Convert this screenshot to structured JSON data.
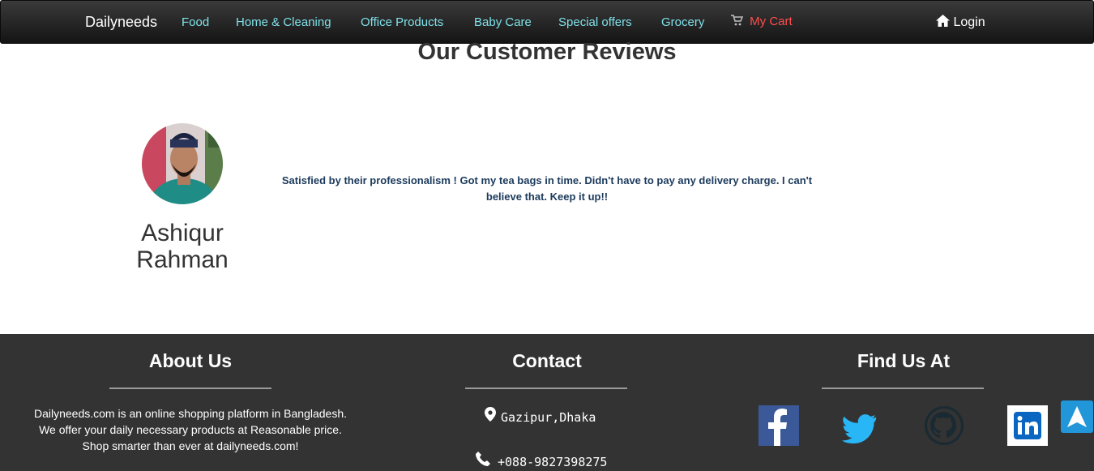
{
  "navbar": {
    "brand": "Dailyneeds",
    "links": [
      "Food",
      "Home & Cleaning",
      "Office Products",
      "Baby Care",
      "Special offers",
      "Grocery"
    ],
    "cart_label": "My Cart",
    "login_label": "Login",
    "link_color": "#7fe0e8",
    "cart_color": "#ff4d4d"
  },
  "reviews": {
    "title": "Our Customer Reviews",
    "items": [
      {
        "name_line1": "Ashiqur",
        "name_line2": "Rahman",
        "text": "Satisfied by their professionalism ! Got my tea bags in time. Didn't have to pay any delivery charge. I can't believe that. Keep it up!!"
      }
    ]
  },
  "footer": {
    "about": {
      "title": "About Us",
      "line1": "Dailyneeds.com is an online shopping platform in Bangladesh.",
      "line2": "We offer your daily necessary products at Reasonable price.",
      "line3": "Shop smarter than ever at dailyneeds.com!"
    },
    "contact": {
      "title": "Contact",
      "address": "Gazipur,Dhaka",
      "phone": "+088-9827398275"
    },
    "find_us": {
      "title": "Find Us At",
      "icons": [
        "facebook-icon",
        "twitter-icon",
        "github-icon",
        "linkedin-icon"
      ]
    }
  },
  "colors": {
    "footer_bg": "#333333",
    "review_text": "#1b3a5c",
    "scroll_button": "#2196d9"
  }
}
